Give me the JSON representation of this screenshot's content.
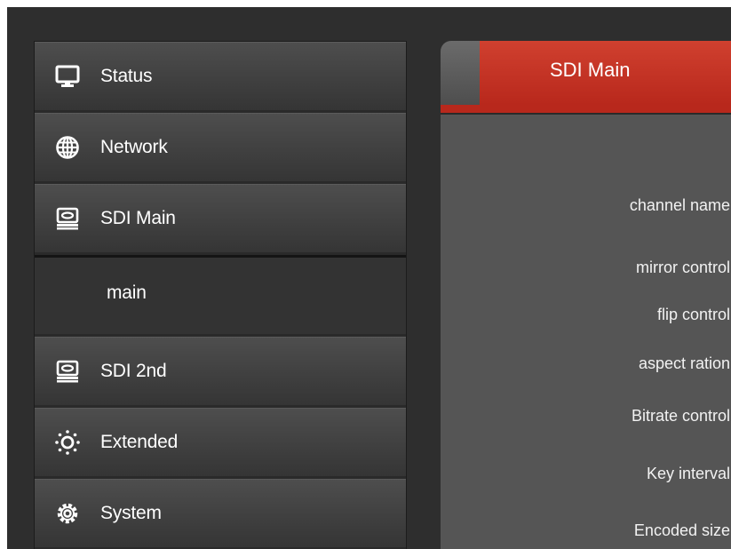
{
  "sidebar": {
    "items": [
      {
        "label": "Status",
        "icon": "monitor-icon"
      },
      {
        "label": "Network",
        "icon": "globe-icon"
      },
      {
        "label": "SDI Main",
        "icon": "hard-drive-icon"
      },
      {
        "label": "main",
        "icon": ""
      },
      {
        "label": "SDI 2nd",
        "icon": "hard-drive-icon"
      },
      {
        "label": "Extended",
        "icon": "sun-gear-icon"
      },
      {
        "label": "System",
        "icon": "gear-icon"
      }
    ]
  },
  "panel": {
    "active_tab": "SDI Main",
    "fields": [
      {
        "label": "channel name"
      },
      {
        "label": "mirror control"
      },
      {
        "label": "flip control"
      },
      {
        "label": "aspect ration"
      },
      {
        "label": "Bitrate control"
      },
      {
        "label": "Key interval"
      },
      {
        "label": "Encoded size"
      }
    ]
  },
  "colors": {
    "accent": "#c0392b",
    "background": "#2e2e2e",
    "panel": "#555555"
  }
}
